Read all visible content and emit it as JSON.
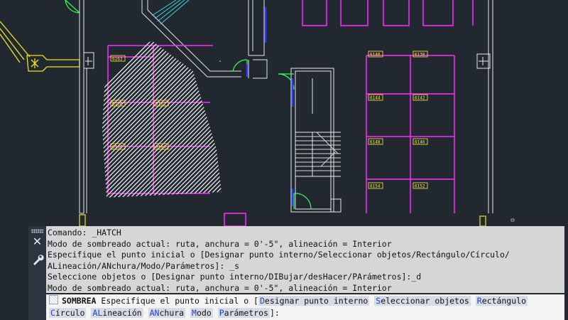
{
  "drawing": {
    "room_tags": [
      "6163",
      "6168",
      "6162",
      "6169",
      "6164",
      "6140",
      "6138",
      "6144",
      "6142",
      "6148",
      "6146",
      "6154",
      "6152"
    ]
  },
  "command_panel": {
    "icons": [
      "grip-icon",
      "close-icon",
      "wrench-icon"
    ],
    "history": [
      "Comando: _HATCH",
      "Modo de sombreado actual: ruta, anchura = 0'-5\", alineación = Interior",
      "Especifique el punto inicial o [Designar punto interno/Seleccionar objetos/Rectángulo/Círculo/",
      "ALineación/ANchura/Modo/Parámetros]: _s",
      "Seleccione objetos o [Designar punto interno/DIBujar/desHacer/PArámetros]:_d",
      "Modo de sombreado actual: ruta, anchura = 0'-5\", alineación = Interior"
    ],
    "prompt": {
      "icon": "hatch-icon",
      "command": "SOMBREA",
      "text": "Especifique el punto inicial o [",
      "options": [
        {
          "key": "D",
          "rest": "esignar punto interno"
        },
        {
          "key": "S",
          "rest": "eleccionar objetos"
        },
        {
          "key": "R",
          "rest": "ectángulo"
        },
        {
          "key": "C",
          "rest": "írculo"
        },
        {
          "key": "AL",
          "rest": "ineación"
        },
        {
          "key": "AN",
          "rest": "chura"
        },
        {
          "key": "M",
          "rest": "odo"
        },
        {
          "key": "P",
          "rest": "arámetros"
        }
      ],
      "suffix": "]:"
    }
  }
}
